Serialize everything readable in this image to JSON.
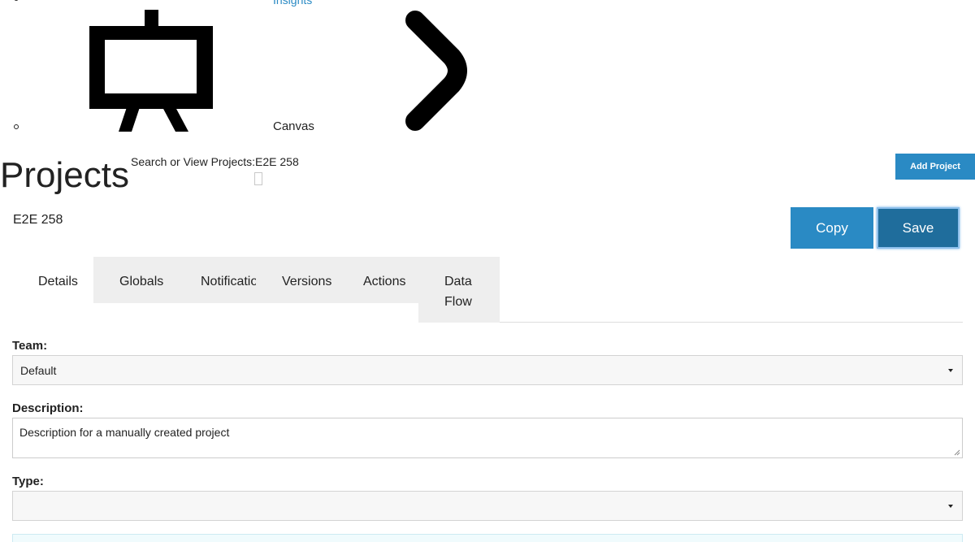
{
  "nav": {
    "insights_label": "Insights",
    "canvas_label": "Canvas",
    "icons": [
      "easel-icon",
      "chevron-right-icon"
    ]
  },
  "header": {
    "title": "Projects",
    "search_label": "Search or View Projects:E2E 258",
    "add_project_label": "Add Project"
  },
  "project": {
    "name": "E2E 258",
    "copy_label": "Copy",
    "save_label": "Save"
  },
  "tabs": [
    {
      "label": "Details",
      "active": true
    },
    {
      "label": "Globals"
    },
    {
      "label": "Notifications"
    },
    {
      "label": "Versions"
    },
    {
      "label": "Actions"
    },
    {
      "label": "Data Flow"
    }
  ],
  "form": {
    "team": {
      "label": "Team:",
      "value": "Default"
    },
    "description": {
      "label": "Description:",
      "value": "Description for a manually created project"
    },
    "type": {
      "label": "Type:",
      "value": ""
    }
  },
  "colors": {
    "accent": "#2a8ac4",
    "save": "#1f6d9c",
    "tab_bg": "#eeeeee"
  }
}
